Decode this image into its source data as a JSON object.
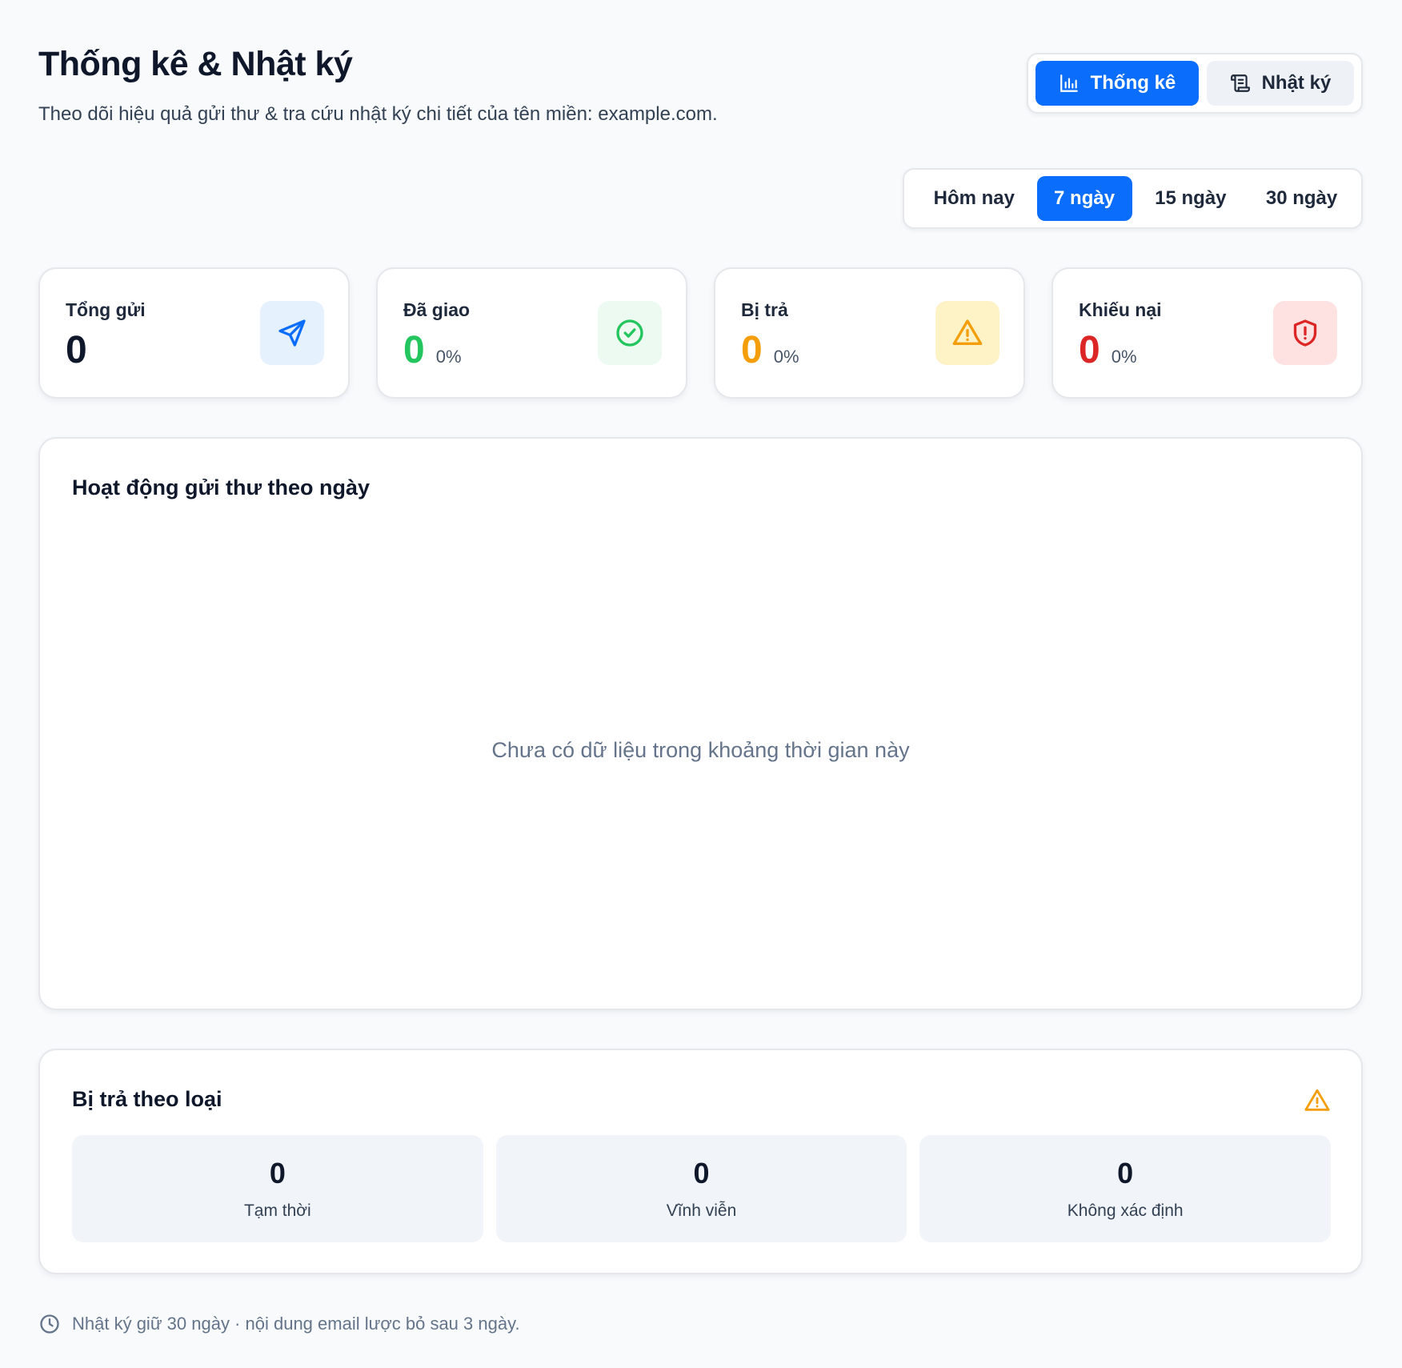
{
  "header": {
    "title": "Thống kê & Nhật ký",
    "subtitle": "Theo dõi hiệu quả gửi thư & tra cứu nhật ký chi tiết của tên miền: example.com."
  },
  "view_tabs": [
    {
      "label": "Thống kê",
      "icon": "bar-chart-icon",
      "active": true
    },
    {
      "label": "Nhật ký",
      "icon": "scroll-icon",
      "active": false
    }
  ],
  "ranges": [
    {
      "label": "Hôm nay",
      "active": false
    },
    {
      "label": "7 ngày",
      "active": true
    },
    {
      "label": "15 ngày",
      "active": false
    },
    {
      "label": "30 ngày",
      "active": false
    }
  ],
  "stats": [
    {
      "label": "Tổng gửi",
      "value": "0",
      "percent": "",
      "color": "#0f172a",
      "icon": "send-icon",
      "icon_bg": "#e6f1fe",
      "icon_color": "#0b6dfb"
    },
    {
      "label": "Đã giao",
      "value": "0",
      "percent": "0%",
      "color": "#22c55e",
      "icon": "check-circle-icon",
      "icon_bg": "#edfaf1",
      "icon_color": "#22c55e"
    },
    {
      "label": "Bị trả",
      "value": "0",
      "percent": "0%",
      "color": "#f59e0b",
      "icon": "warning-icon",
      "icon_bg": "#fef3c7",
      "icon_color": "#f59e0b"
    },
    {
      "label": "Khiếu nại",
      "value": "0",
      "percent": "0%",
      "color": "#dc2626",
      "icon": "shield-alert-icon",
      "icon_bg": "#fee2e2",
      "icon_color": "#dc2626"
    }
  ],
  "activity": {
    "title": "Hoạt động gửi thư theo ngày",
    "empty_message": "Chưa có dữ liệu trong khoảng thời gian này"
  },
  "bounces": {
    "title": "Bị trả theo loại",
    "items": [
      {
        "value": "0",
        "label": "Tạm thời"
      },
      {
        "value": "0",
        "label": "Vĩnh viễn"
      },
      {
        "value": "0",
        "label": "Không xác định"
      }
    ]
  },
  "footer": {
    "note": "Nhật ký giữ 30 ngày · nội dung email lược bỏ sau 3 ngày."
  },
  "colors": {
    "accent": "#0b6dfb",
    "success": "#22c55e",
    "warning": "#f59e0b",
    "danger": "#dc2626"
  }
}
